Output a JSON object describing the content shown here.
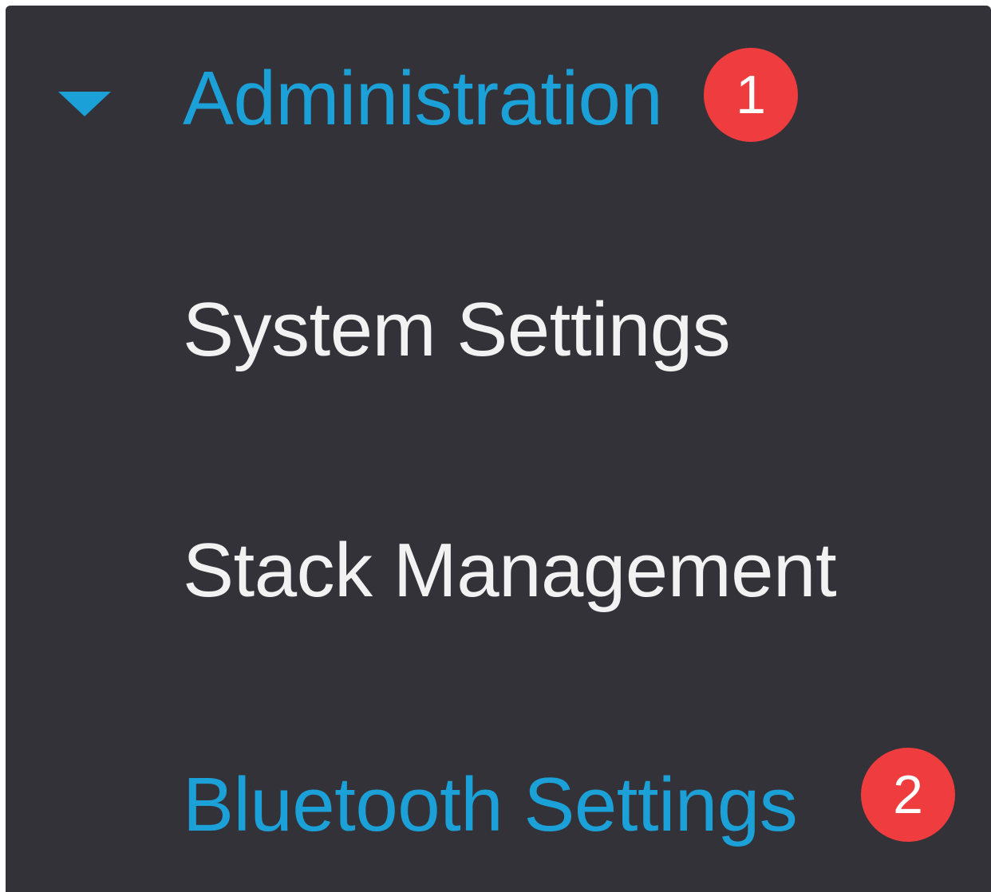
{
  "menu": {
    "section": {
      "label": "Administration",
      "icon": "caret-down-icon",
      "expanded": true,
      "badge": "1"
    },
    "items": [
      {
        "label": "System Settings",
        "active": false
      },
      {
        "label": "Stack Management",
        "active": false
      },
      {
        "label": "Bluetooth Settings",
        "active": true,
        "badge": "2"
      }
    ]
  },
  "colors": {
    "background": "#333238",
    "accent": "#1ba0d7",
    "text": "#f2f2f2",
    "badge": "#ef3d3f"
  }
}
